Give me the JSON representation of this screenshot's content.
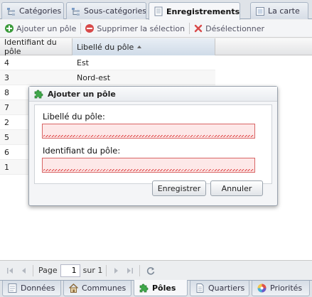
{
  "top_tabs": [
    {
      "label": "Catégories",
      "icon": "category-tree-icon",
      "active": false
    },
    {
      "label": "Sous-catégories",
      "icon": "subcategory-tree-icon",
      "active": false
    },
    {
      "label": "Enregistrements",
      "icon": "records-icon",
      "active": true
    },
    {
      "label": "La carte",
      "icon": "map-icon",
      "active": false
    }
  ],
  "toolbar": {
    "add_label": "Ajouter un pôle",
    "delete_label": "Supprimer la sélection",
    "deselect_label": "Désélectionner"
  },
  "grid": {
    "columns": [
      "Identifiant du pôle",
      "Libellé du pôle"
    ],
    "sort_column": "Libellé du pôle",
    "rows": [
      {
        "id": "4",
        "label": "Est"
      },
      {
        "id": "3",
        "label": "Nord-est"
      },
      {
        "id": "8",
        "label": ""
      },
      {
        "id": "7",
        "label": ""
      },
      {
        "id": "2",
        "label": ""
      },
      {
        "id": "5",
        "label": ""
      },
      {
        "id": "6",
        "label": ""
      },
      {
        "id": "1",
        "label": ""
      }
    ]
  },
  "pager": {
    "page_label": "Page",
    "page_value": "1",
    "of_label": "sur 1"
  },
  "dialog": {
    "title": "Ajouter un pôle",
    "field1_label": "Libellé du pôle:",
    "field1_value": "",
    "field2_label": "Identifiant du pôle:",
    "field2_value": "",
    "save_label": "Enregistrer",
    "cancel_label": "Annuler"
  },
  "bottom_tabs": [
    {
      "label": "Données",
      "icon": "data-icon",
      "active": false
    },
    {
      "label": "Communes",
      "icon": "house-icon",
      "active": false
    },
    {
      "label": "Pôles",
      "icon": "puzzle-icon",
      "active": true
    },
    {
      "label": "Quartiers",
      "icon": "document-icon",
      "active": false
    },
    {
      "label": "Priorités",
      "icon": "color-wheel-icon",
      "active": false
    }
  ],
  "colors": {
    "accent_green": "#3a9a3a",
    "delete_red": "#d84a4a",
    "invalid_field": "#fde8e8"
  }
}
